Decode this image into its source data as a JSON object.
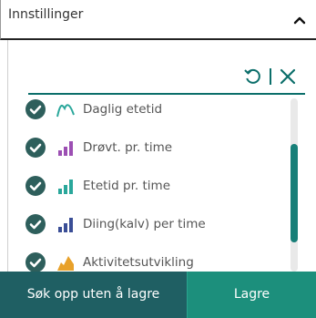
{
  "header": {
    "title": "Innstillinger",
    "icon": "chevron-up-icon"
  },
  "toolbar": {
    "reset_icon": "reset-icon",
    "close_icon": "close-icon"
  },
  "list": {
    "items": [
      {
        "label": "Daglig etetid",
        "icon": "curve-chart-icon",
        "checked": true
      },
      {
        "label": "Drøvt. pr. time",
        "icon": "bar-chart-icon",
        "checked": true
      },
      {
        "label": "Etetid pr. time",
        "icon": "bar-chart-icon",
        "checked": true
      },
      {
        "label": "Diing(kalv) per time",
        "icon": "bar-chart-icon",
        "checked": true
      },
      {
        "label": "Aktivitetsutvikling",
        "icon": "area-chart-icon",
        "checked": true
      }
    ]
  },
  "footer": {
    "secondary_label": "Søk opp uten å lagre",
    "primary_label": "Lagre"
  },
  "colors": {
    "accent": "#0b6e6a",
    "check": "#2e5f5c",
    "scroll_thumb": "#177f78",
    "btn_secondary": "#1f5f63",
    "btn_primary": "#1c8f7c",
    "purple": "#9c4fb3",
    "teal": "#2aa79b",
    "navy": "#3a4e96",
    "orange": "#e8a12a"
  }
}
